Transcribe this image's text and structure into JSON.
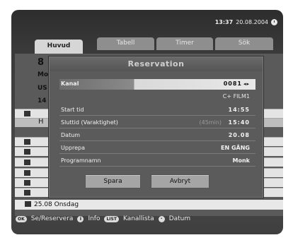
{
  "status": {
    "time": "13:37",
    "date": "20.08.2004"
  },
  "tabs": [
    {
      "label": "Huvud"
    },
    {
      "label": "Tabell"
    },
    {
      "label": "Timer"
    },
    {
      "label": "Sök"
    }
  ],
  "background": {
    "big_digit": "8",
    "line1": "Mo",
    "line2": "US",
    "line3": "14",
    "partial_h": "H",
    "last_row_label": "25.08 Onsdag"
  },
  "dialog": {
    "title": "Reservation",
    "fields": {
      "channel": {
        "label": "Kanal",
        "value": "0081"
      },
      "channel_name": {
        "value": "C+ FILM1"
      },
      "start": {
        "label": "Start tid",
        "value": "14:55"
      },
      "end": {
        "label": "Sluttid (Varaktighet)",
        "duration": "(45min)",
        "value": "15:40"
      },
      "date": {
        "label": "Datum",
        "value": "20.08"
      },
      "repeat": {
        "label": "Upprepa",
        "value": "EN GÅNG"
      },
      "program": {
        "label": "Programnamn",
        "value": "Monk"
      }
    },
    "buttons": {
      "save": "Spara",
      "cancel": "Avbryt"
    }
  },
  "help": {
    "ok_key": "OK",
    "ok_label": "Se/Reservera",
    "info_key": "i",
    "info_label": "Info",
    "list_key": "LIST",
    "list_label": "Kanallista",
    "date_label": "Datum"
  },
  "colors": {
    "screen_bg": "#3a3a3a",
    "dialog_bg": "#5b5b5b",
    "button_bg": "#a5a5a5",
    "list_row_bg": "#e4e4e4"
  }
}
